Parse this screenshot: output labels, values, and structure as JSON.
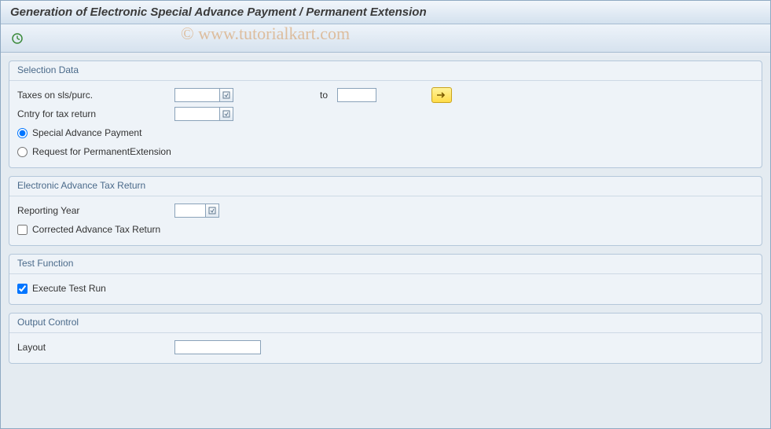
{
  "title": "Generation of Electronic Special Advance Payment / Permanent Extension",
  "watermark": "© www.tutorialkart.com",
  "groups": {
    "selection": {
      "title": "Selection Data",
      "taxes_label": "Taxes on sls/purc.",
      "taxes_value": "",
      "to_label": "to",
      "to_value": "",
      "country_label": "Cntry for tax return",
      "country_value": "",
      "radio_special": "Special Advance Payment",
      "radio_request": "Request for PermanentExtension",
      "radio_selected": "special"
    },
    "electronic": {
      "title": "Electronic Advance Tax Return",
      "reporting_year_label": "Reporting Year",
      "reporting_year_value": "",
      "corrected_label": "Corrected Advance Tax Return",
      "corrected_checked": false
    },
    "test": {
      "title": "Test Function",
      "execute_label": "Execute Test Run",
      "execute_checked": true
    },
    "output": {
      "title": "Output Control",
      "layout_label": "Layout",
      "layout_value": ""
    }
  }
}
